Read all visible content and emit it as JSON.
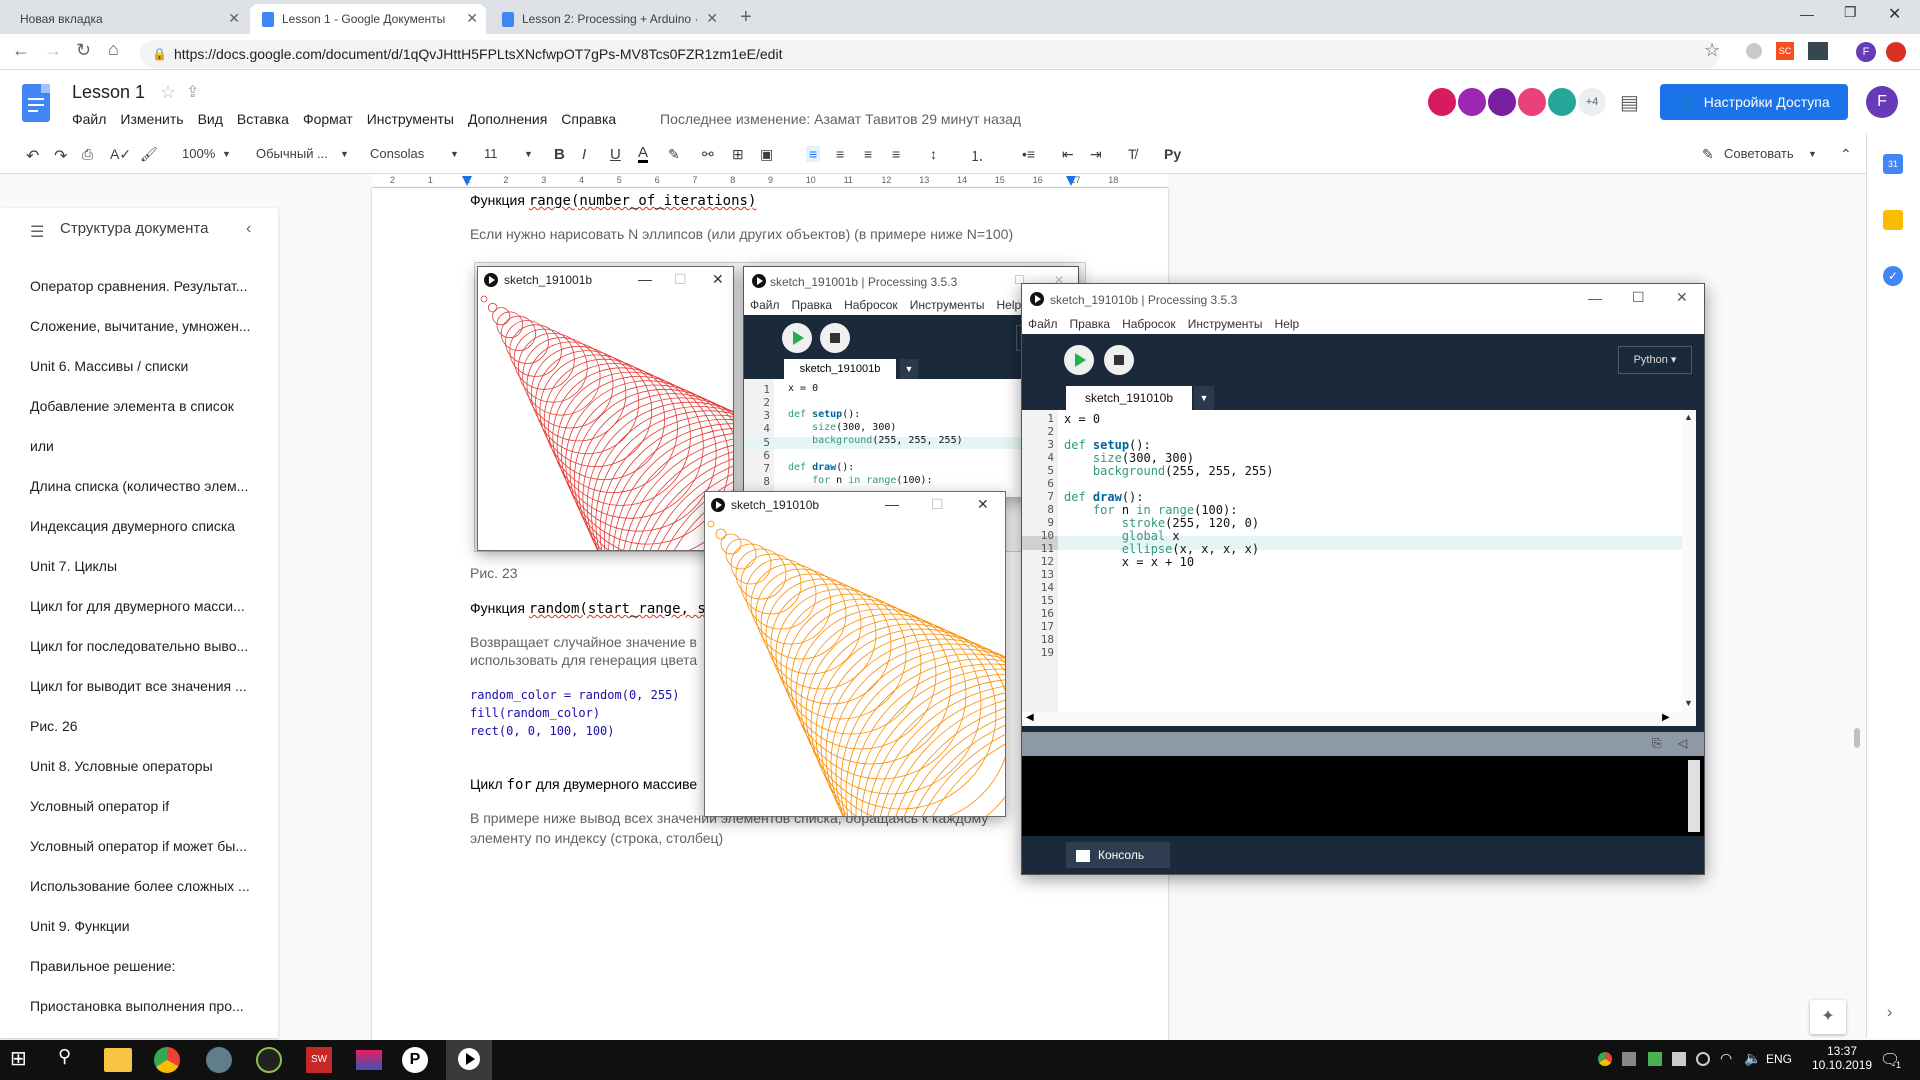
{
  "browser": {
    "tabs": [
      {
        "label": "Новая вкладка"
      },
      {
        "label": "Lesson 1 - Google Документы"
      },
      {
        "label": "Lesson 2: Processing + Arduino ·"
      }
    ],
    "url": "https://docs.google.com/document/d/1qQvJHttH5FPLtsXNcfwpOT7gPs-MV8Tcs0FZR1zm1eE/edit"
  },
  "docs": {
    "title": "Lesson 1",
    "menus": [
      "Файл",
      "Изменить",
      "Вид",
      "Вставка",
      "Формат",
      "Инструменты",
      "Дополнения",
      "Справка"
    ],
    "last_edit": "Последнее изменение: Азамат Тавитов 29 минут назад",
    "collab_more": "+4",
    "share_label": "Настройки Доступа",
    "user_initial": "F",
    "toolbar": {
      "zoom": "100%",
      "style": "Обычный ...",
      "font": "Consolas",
      "size": "11",
      "suggest": "Советовать"
    },
    "ruler_numbers": [
      "2",
      "1",
      "1",
      "2",
      "3",
      "4",
      "5",
      "6",
      "7",
      "8",
      "9",
      "10",
      "11",
      "12",
      "13",
      "14",
      "15",
      "16",
      "17",
      "18"
    ]
  },
  "outline": {
    "title": "Структура документа",
    "items": [
      "Оператор сравнения. Результат...",
      "Сложение, вычитание, умножен...",
      "Unit 6. Массивы / списки",
      "Добавление элемента в список",
      "или",
      "Длина списка (количество элем...",
      "Индексация двумерного списка",
      "Unit 7. Циклы",
      "Цикл for для двумерного масси...",
      "Цикл for последовательно выво...",
      "Цикл for выводит все значения ...",
      "Рис. 26",
      "Unit 8. Условные операторы",
      "Условный оператор if",
      "Условный оператор if может бы...",
      "Использование более сложных ...",
      "Unit 9. Функции",
      "Правильное решение:",
      "Приостановка выполнения про..."
    ]
  },
  "page": {
    "heading1_prefix": "Функция ",
    "heading1_code": "range(number_of_iterations)",
    "para1": "Если нужно нарисовать N эллипсов (или других объектов) (в примере ниже N=100)",
    "fig_caption": "Рис. 23",
    "heading2_prefix": "Функция ",
    "heading2_code": "random(start_range, s",
    "para2_line1": "Возвращает случайное значение в",
    "para2_line2": "использовать для генерация цвета",
    "code_lines": [
      "random_color = random(0, 255)",
      "fill(random_color)",
      "rect(0, 0, 100, 100)"
    ],
    "heading3_prefix": "Цикл ",
    "heading3_code": "for",
    "heading3_suffix": " для двумерного массиве",
    "para3_line1": "В примере ниже вывод всех значений элементов списка, обращаясь к каждому",
    "para3_line2": "элементу по индексу (строка, столбец)"
  },
  "sketch1": {
    "title": "sketch_191001b",
    "stroke": "#e53935"
  },
  "sketch2": {
    "title": "sketch_191010b",
    "stroke": "#fb8c00"
  },
  "ide_back": {
    "title": "sketch_191001b | Processing 3.5.3",
    "menus": [
      "Файл",
      "Правка",
      "Набросок",
      "Инструменты",
      "Help"
    ],
    "tab": "sketch_191001b",
    "mode_partial": "P"
  },
  "ide_front": {
    "title": "sketch_191010b | Processing 3.5.3",
    "menus": [
      "Файл",
      "Правка",
      "Набросок",
      "Инструменты",
      "Help"
    ],
    "tab": "sketch_191010b",
    "mode": "Python ▾",
    "console_label": "Консоль",
    "line_numbers": [
      "1",
      "2",
      "3",
      "4",
      "5",
      "6",
      "7",
      "8",
      "9",
      "10",
      "11",
      "12",
      "13",
      "14",
      "15",
      "16",
      "17",
      "18",
      "19"
    ]
  },
  "taskbar": {
    "lang": "ENG",
    "time": "13:37",
    "date": "10.10.2019",
    "notif_count": "1"
  }
}
